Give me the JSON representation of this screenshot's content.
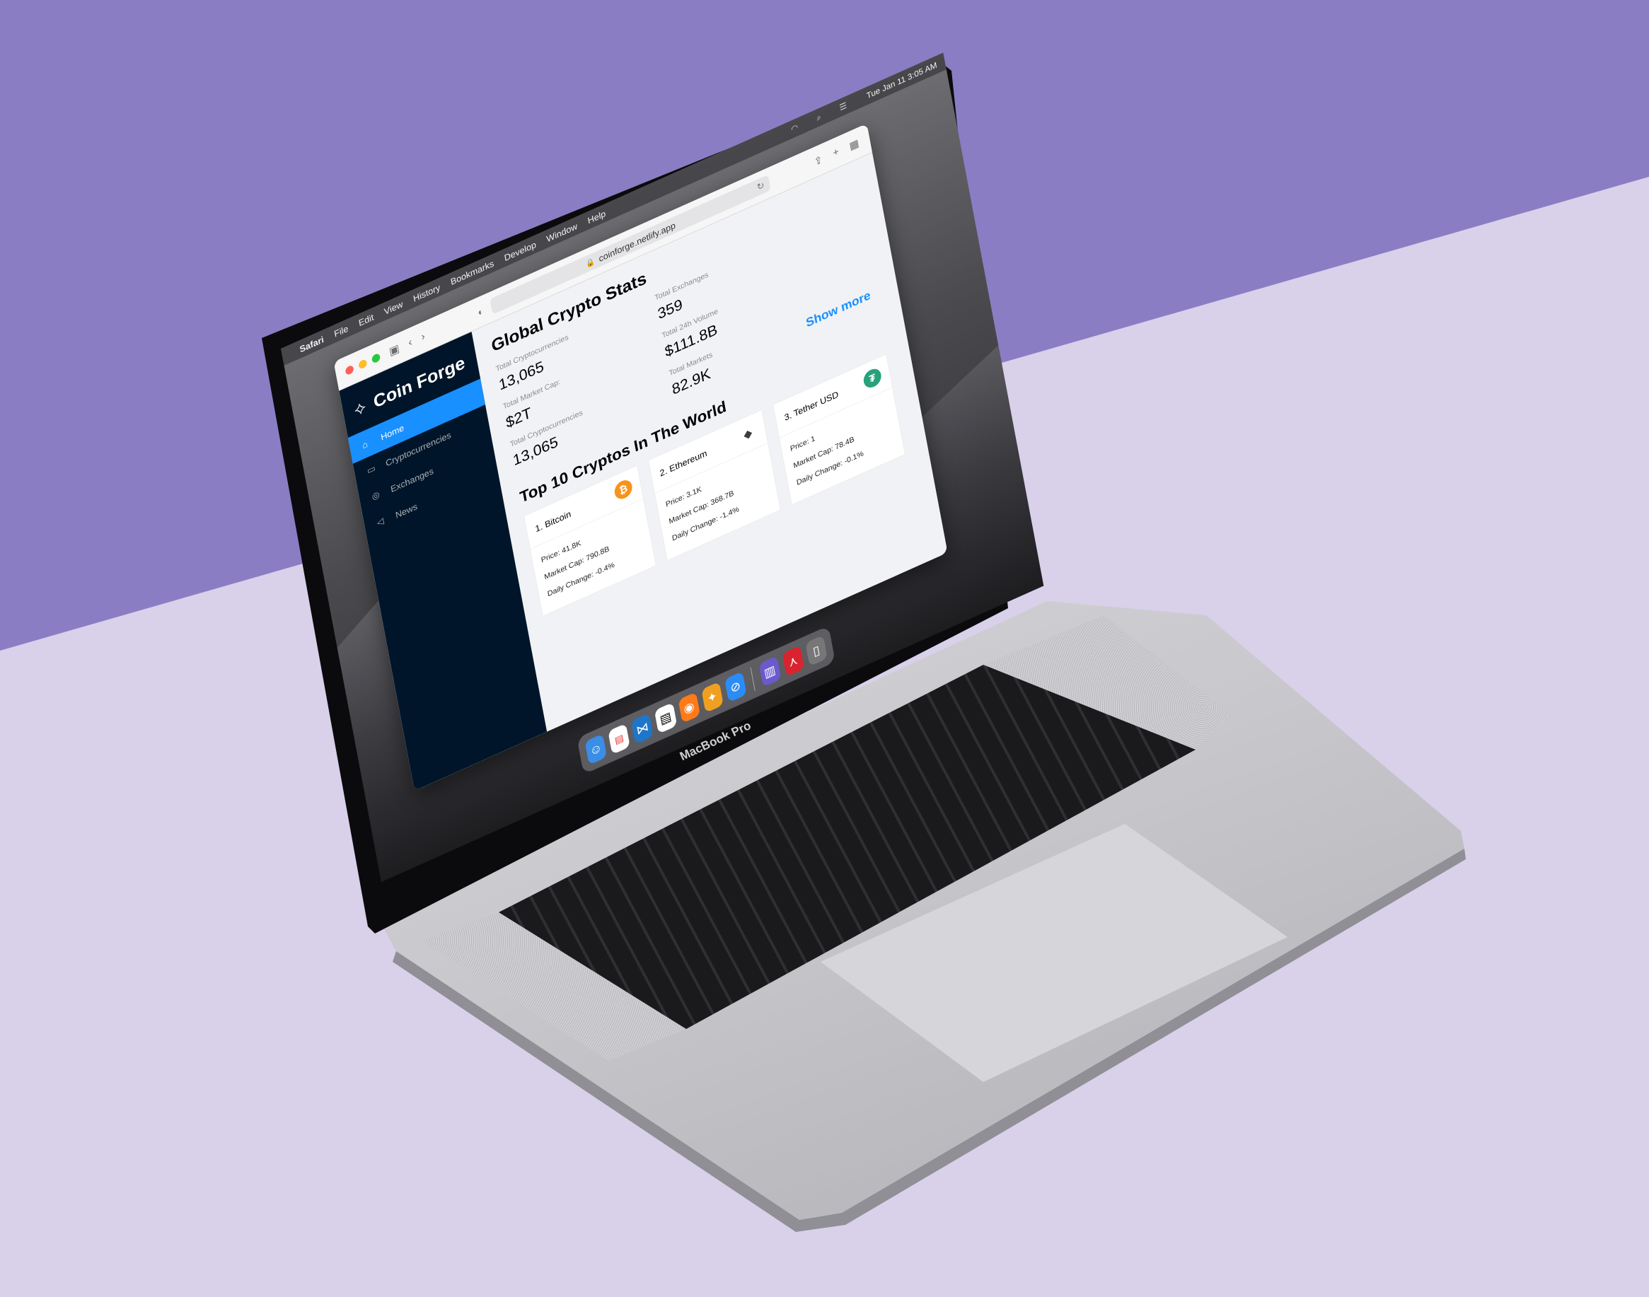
{
  "menubar": {
    "apple": "",
    "app_name": "Safari",
    "items": [
      "File",
      "Edit",
      "View",
      "History",
      "Bookmarks",
      "Develop",
      "Window",
      "Help"
    ],
    "clock": "Tue Jan 11  3:05 AM"
  },
  "browser": {
    "url": "coinforge.netlify.app"
  },
  "sidebar": {
    "brand": "Coin Forge",
    "items": [
      {
        "label": "Home",
        "icon": "home-icon",
        "active": true
      },
      {
        "label": "Cryptocurrencies",
        "icon": "money-icon",
        "active": false
      },
      {
        "label": "Exchanges",
        "icon": "bulb-icon",
        "active": false
      },
      {
        "label": "News",
        "icon": "megaphone-icon",
        "active": false
      }
    ]
  },
  "stats": {
    "title": "Global Crypto Stats",
    "items": [
      {
        "label": "Total Cryptocurrencies",
        "value": "13,065"
      },
      {
        "label": "Total Exchanges",
        "value": "359"
      },
      {
        "label": "Total Market Cap:",
        "value": "$2T"
      },
      {
        "label": "Total 24h Volume",
        "value": "$111.8B"
      },
      {
        "label": "Total Cryptocurrencies",
        "value": "13,065"
      },
      {
        "label": "Total Markets",
        "value": "82.9K"
      }
    ],
    "show_more": "Show more"
  },
  "top": {
    "title": "Top 10 Cryptos In The World",
    "cards": [
      {
        "name": "1. Bitcoin",
        "price": "Price: 41.8K",
        "market_cap": "Market Cap: 790.8B",
        "change": "Daily Change: -0.4%",
        "icon": "bitcoin-icon",
        "color": "#f7931a"
      },
      {
        "name": "2. Ethereum",
        "price": "Price: 3.1K",
        "market_cap": "Market Cap: 368.7B",
        "change": "Daily Change: -1.4%",
        "icon": "ethereum-icon",
        "color": "#3c3c3d"
      },
      {
        "name": "3. Tether USD",
        "price": "Price: 1",
        "market_cap": "Market Cap: 78.4B",
        "change": "Daily Change: -0.1%",
        "icon": "tether-icon",
        "color": "#26a17b"
      }
    ]
  },
  "device": {
    "label": "MacBook Pro"
  },
  "colors": {
    "sidebar": "#001529",
    "accent": "#1890ff",
    "bg_top": "#8b7dc4",
    "bg_bottom": "#d9d0ea"
  }
}
